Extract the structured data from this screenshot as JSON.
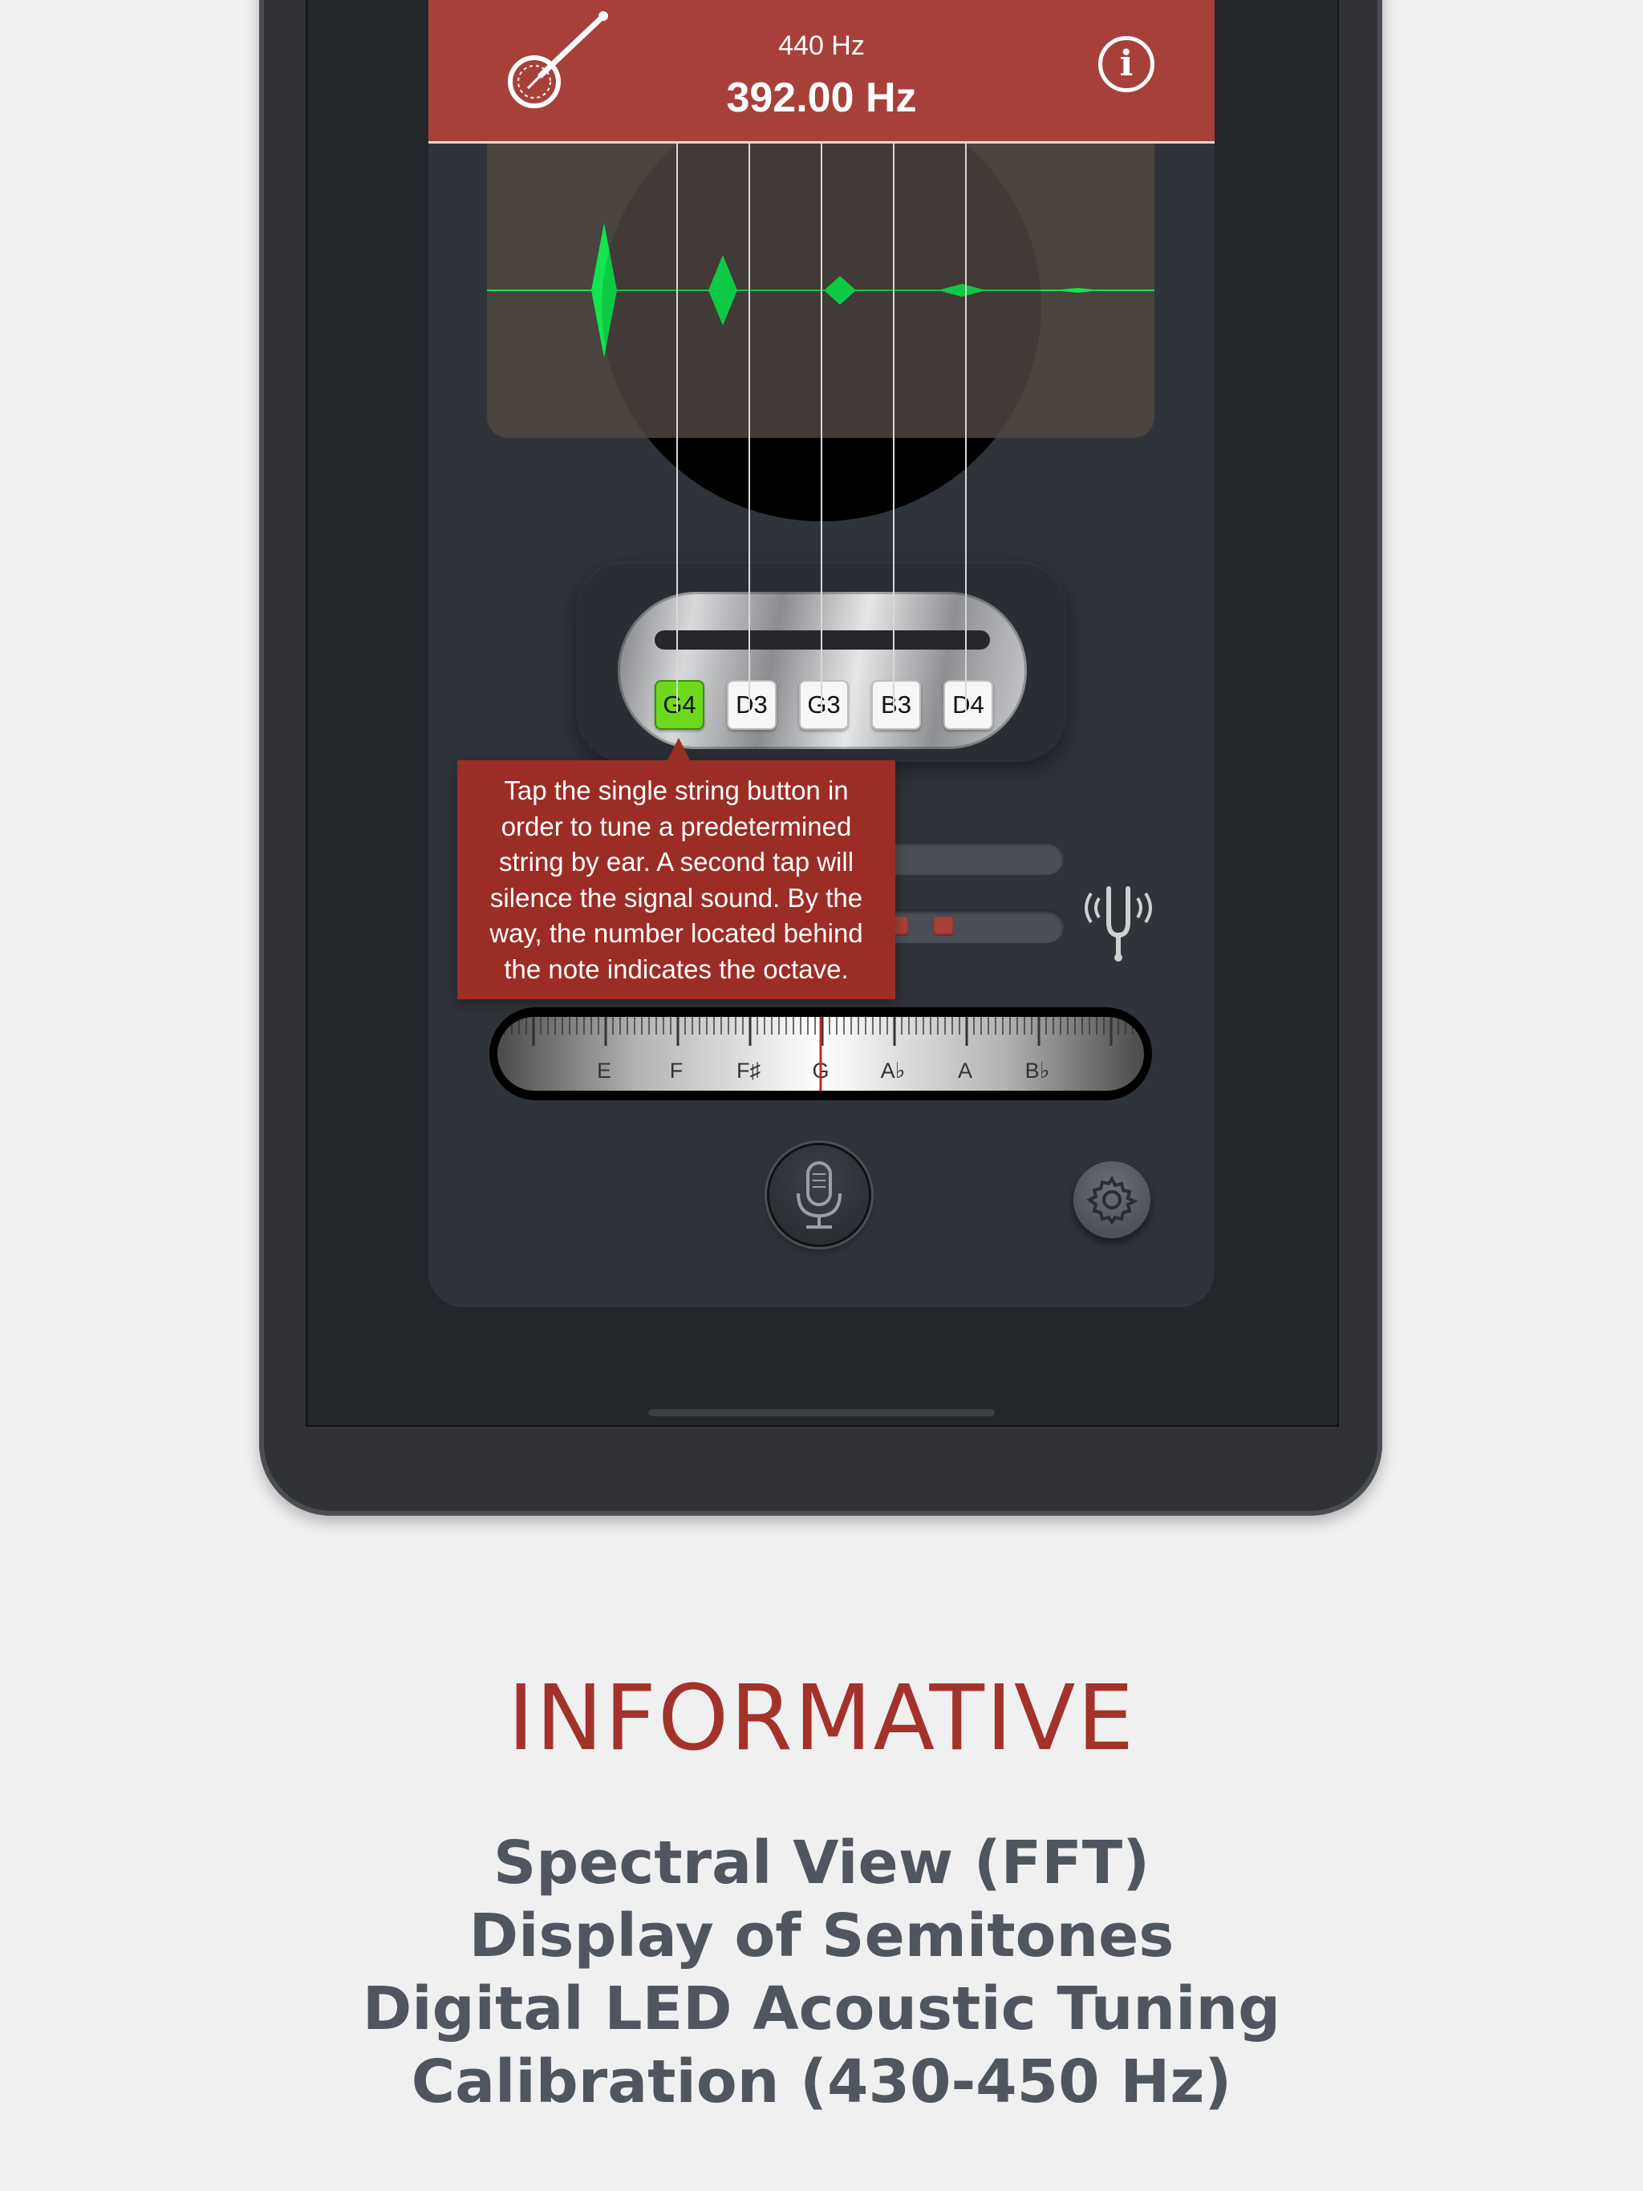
{
  "header": {
    "reference_hz": "440 Hz",
    "frequency": "392.00 Hz"
  },
  "strings": [
    {
      "label": "G4",
      "active": true
    },
    {
      "label": "D3",
      "active": false
    },
    {
      "label": "G3",
      "active": false
    },
    {
      "label": "B3",
      "active": false
    },
    {
      "label": "D4",
      "active": false
    }
  ],
  "tooltip": {
    "lines": [
      "Tap the single string button in",
      "order to tune a predetermined",
      "string by ear. A second tap will",
      "silence the signal sound. By the",
      "way, the number located behind",
      "the note indicates the octave."
    ]
  },
  "meter": {
    "notes": [
      "E",
      "F",
      "F♯",
      "G",
      "A♭",
      "A",
      "B♭"
    ],
    "current_note": "G"
  },
  "caption": {
    "title": "INFORMATIVE",
    "lines": [
      "Spectral View (FFT)",
      "Display of Semitones",
      "Digital LED Acoustic Tuning",
      "Calibration (430-450 Hz)"
    ]
  },
  "colors": {
    "accent": "#a8403a",
    "spectrum": "#11e54f",
    "active_string": "#6ed81c",
    "caption_title": "#a3322b",
    "caption_text": "#505660"
  },
  "icons": [
    "banjo-icon",
    "info-icon",
    "tuning-fork-icon",
    "microphone-icon",
    "gear-icon"
  ]
}
